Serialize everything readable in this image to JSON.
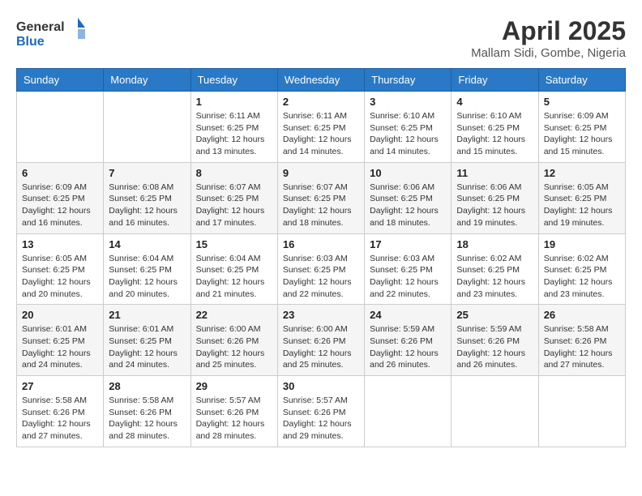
{
  "header": {
    "logo_line1": "General",
    "logo_line2": "Blue",
    "month_title": "April 2025",
    "location": "Mallam Sidi, Gombe, Nigeria"
  },
  "weekdays": [
    "Sunday",
    "Monday",
    "Tuesday",
    "Wednesday",
    "Thursday",
    "Friday",
    "Saturday"
  ],
  "weeks": [
    [
      {
        "day": "",
        "sunrise": "",
        "sunset": "",
        "daylight": ""
      },
      {
        "day": "",
        "sunrise": "",
        "sunset": "",
        "daylight": ""
      },
      {
        "day": "1",
        "sunrise": "Sunrise: 6:11 AM",
        "sunset": "Sunset: 6:25 PM",
        "daylight": "Daylight: 12 hours and 13 minutes."
      },
      {
        "day": "2",
        "sunrise": "Sunrise: 6:11 AM",
        "sunset": "Sunset: 6:25 PM",
        "daylight": "Daylight: 12 hours and 14 minutes."
      },
      {
        "day": "3",
        "sunrise": "Sunrise: 6:10 AM",
        "sunset": "Sunset: 6:25 PM",
        "daylight": "Daylight: 12 hours and 14 minutes."
      },
      {
        "day": "4",
        "sunrise": "Sunrise: 6:10 AM",
        "sunset": "Sunset: 6:25 PM",
        "daylight": "Daylight: 12 hours and 15 minutes."
      },
      {
        "day": "5",
        "sunrise": "Sunrise: 6:09 AM",
        "sunset": "Sunset: 6:25 PM",
        "daylight": "Daylight: 12 hours and 15 minutes."
      }
    ],
    [
      {
        "day": "6",
        "sunrise": "Sunrise: 6:09 AM",
        "sunset": "Sunset: 6:25 PM",
        "daylight": "Daylight: 12 hours and 16 minutes."
      },
      {
        "day": "7",
        "sunrise": "Sunrise: 6:08 AM",
        "sunset": "Sunset: 6:25 PM",
        "daylight": "Daylight: 12 hours and 16 minutes."
      },
      {
        "day": "8",
        "sunrise": "Sunrise: 6:07 AM",
        "sunset": "Sunset: 6:25 PM",
        "daylight": "Daylight: 12 hours and 17 minutes."
      },
      {
        "day": "9",
        "sunrise": "Sunrise: 6:07 AM",
        "sunset": "Sunset: 6:25 PM",
        "daylight": "Daylight: 12 hours and 18 minutes."
      },
      {
        "day": "10",
        "sunrise": "Sunrise: 6:06 AM",
        "sunset": "Sunset: 6:25 PM",
        "daylight": "Daylight: 12 hours and 18 minutes."
      },
      {
        "day": "11",
        "sunrise": "Sunrise: 6:06 AM",
        "sunset": "Sunset: 6:25 PM",
        "daylight": "Daylight: 12 hours and 19 minutes."
      },
      {
        "day": "12",
        "sunrise": "Sunrise: 6:05 AM",
        "sunset": "Sunset: 6:25 PM",
        "daylight": "Daylight: 12 hours and 19 minutes."
      }
    ],
    [
      {
        "day": "13",
        "sunrise": "Sunrise: 6:05 AM",
        "sunset": "Sunset: 6:25 PM",
        "daylight": "Daylight: 12 hours and 20 minutes."
      },
      {
        "day": "14",
        "sunrise": "Sunrise: 6:04 AM",
        "sunset": "Sunset: 6:25 PM",
        "daylight": "Daylight: 12 hours and 20 minutes."
      },
      {
        "day": "15",
        "sunrise": "Sunrise: 6:04 AM",
        "sunset": "Sunset: 6:25 PM",
        "daylight": "Daylight: 12 hours and 21 minutes."
      },
      {
        "day": "16",
        "sunrise": "Sunrise: 6:03 AM",
        "sunset": "Sunset: 6:25 PM",
        "daylight": "Daylight: 12 hours and 22 minutes."
      },
      {
        "day": "17",
        "sunrise": "Sunrise: 6:03 AM",
        "sunset": "Sunset: 6:25 PM",
        "daylight": "Daylight: 12 hours and 22 minutes."
      },
      {
        "day": "18",
        "sunrise": "Sunrise: 6:02 AM",
        "sunset": "Sunset: 6:25 PM",
        "daylight": "Daylight: 12 hours and 23 minutes."
      },
      {
        "day": "19",
        "sunrise": "Sunrise: 6:02 AM",
        "sunset": "Sunset: 6:25 PM",
        "daylight": "Daylight: 12 hours and 23 minutes."
      }
    ],
    [
      {
        "day": "20",
        "sunrise": "Sunrise: 6:01 AM",
        "sunset": "Sunset: 6:25 PM",
        "daylight": "Daylight: 12 hours and 24 minutes."
      },
      {
        "day": "21",
        "sunrise": "Sunrise: 6:01 AM",
        "sunset": "Sunset: 6:25 PM",
        "daylight": "Daylight: 12 hours and 24 minutes."
      },
      {
        "day": "22",
        "sunrise": "Sunrise: 6:00 AM",
        "sunset": "Sunset: 6:26 PM",
        "daylight": "Daylight: 12 hours and 25 minutes."
      },
      {
        "day": "23",
        "sunrise": "Sunrise: 6:00 AM",
        "sunset": "Sunset: 6:26 PM",
        "daylight": "Daylight: 12 hours and 25 minutes."
      },
      {
        "day": "24",
        "sunrise": "Sunrise: 5:59 AM",
        "sunset": "Sunset: 6:26 PM",
        "daylight": "Daylight: 12 hours and 26 minutes."
      },
      {
        "day": "25",
        "sunrise": "Sunrise: 5:59 AM",
        "sunset": "Sunset: 6:26 PM",
        "daylight": "Daylight: 12 hours and 26 minutes."
      },
      {
        "day": "26",
        "sunrise": "Sunrise: 5:58 AM",
        "sunset": "Sunset: 6:26 PM",
        "daylight": "Daylight: 12 hours and 27 minutes."
      }
    ],
    [
      {
        "day": "27",
        "sunrise": "Sunrise: 5:58 AM",
        "sunset": "Sunset: 6:26 PM",
        "daylight": "Daylight: 12 hours and 27 minutes."
      },
      {
        "day": "28",
        "sunrise": "Sunrise: 5:58 AM",
        "sunset": "Sunset: 6:26 PM",
        "daylight": "Daylight: 12 hours and 28 minutes."
      },
      {
        "day": "29",
        "sunrise": "Sunrise: 5:57 AM",
        "sunset": "Sunset: 6:26 PM",
        "daylight": "Daylight: 12 hours and 28 minutes."
      },
      {
        "day": "30",
        "sunrise": "Sunrise: 5:57 AM",
        "sunset": "Sunset: 6:26 PM",
        "daylight": "Daylight: 12 hours and 29 minutes."
      },
      {
        "day": "",
        "sunrise": "",
        "sunset": "",
        "daylight": ""
      },
      {
        "day": "",
        "sunrise": "",
        "sunset": "",
        "daylight": ""
      },
      {
        "day": "",
        "sunrise": "",
        "sunset": "",
        "daylight": ""
      }
    ]
  ]
}
